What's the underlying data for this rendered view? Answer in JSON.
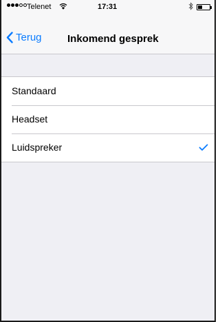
{
  "status_bar": {
    "signal_bars_filled": 3,
    "signal_bars_total": 5,
    "carrier": "Telenet",
    "wifi_icon": "wifi-icon",
    "time": "17:31",
    "bluetooth_icon": "bluetooth-icon",
    "battery_level": 0.4
  },
  "nav": {
    "back_label": "Terug",
    "title": "Inkomend gesprek"
  },
  "options": [
    {
      "label": "Standaard",
      "selected": false
    },
    {
      "label": "Headset",
      "selected": false
    },
    {
      "label": "Luidspreker",
      "selected": true
    }
  ],
  "colors": {
    "accent": "#0a7cff",
    "background": "#efeff4",
    "separator": "#c8c7cc"
  }
}
